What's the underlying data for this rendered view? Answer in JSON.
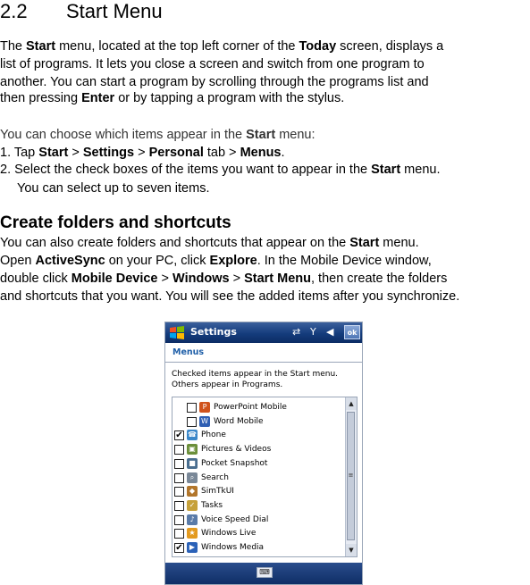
{
  "section": {
    "number": "2.2",
    "title": "Start Menu"
  },
  "intro": {
    "l1": [
      "The ",
      "Start",
      " menu, located at the top left corner of the ",
      "Today",
      " screen, displays a"
    ],
    "l2": "list of programs. It lets you close a screen and switch from one program to",
    "l3": "another. You can start a program by scrolling through the programs list and",
    "l4": [
      "then pressing ",
      "Enter",
      " or by tapping a program with the stylus."
    ]
  },
  "choose": {
    "l1": [
      "You can choose which items appear in the ",
      "Start",
      " menu:"
    ],
    "s1": [
      "1. Tap ",
      "Start",
      " > ",
      "Settings",
      " > ",
      "Personal",
      " tab > ",
      "Menus",
      "."
    ],
    "s2": [
      "2. Select the check boxes of the items you want to appear in the ",
      "Start",
      " menu."
    ],
    "s2b": "You can select up to seven items."
  },
  "folders": {
    "heading": "Create folders and shortcuts",
    "l1": [
      "You can also create folders and shortcuts that appear on the ",
      "Start",
      " menu."
    ],
    "l2": [
      "Open ",
      "ActiveSync",
      " on your PC, click ",
      "Explore",
      ". In the Mobile Device window,"
    ],
    "l3": [
      "double click ",
      "Mobile Device",
      " > ",
      "Windows",
      " > ",
      "Start Menu",
      ", then create the folders"
    ],
    "l4": "and shortcuts that you want. You will see the added items after you synchronize."
  },
  "device": {
    "title": "Settings",
    "ok": "ok",
    "tab": "Menus",
    "note1": "Checked items appear in the Start menu.",
    "note2": "Others appear in Programs.",
    "items": [
      {
        "label": "PowerPoint Mobile",
        "checked": false,
        "indent": true,
        "color": "#d0531c",
        "glyph": "P"
      },
      {
        "label": "Word Mobile",
        "checked": false,
        "indent": true,
        "color": "#2f5fb3",
        "glyph": "W"
      },
      {
        "label": "Phone",
        "checked": true,
        "indent": false,
        "color": "#3a87c9",
        "glyph": "☎"
      },
      {
        "label": "Pictures & Videos",
        "checked": false,
        "indent": false,
        "color": "#6b8f3a",
        "glyph": "▣"
      },
      {
        "label": "Pocket Snapshot",
        "checked": false,
        "indent": false,
        "color": "#4a6e8f",
        "glyph": "■"
      },
      {
        "label": "Search",
        "checked": false,
        "indent": false,
        "color": "#7a8898",
        "glyph": "⌕"
      },
      {
        "label": "SimTkUI",
        "checked": false,
        "indent": false,
        "color": "#b2762b",
        "glyph": "◆"
      },
      {
        "label": "Tasks",
        "checked": false,
        "indent": false,
        "color": "#c6a13a",
        "glyph": "✓"
      },
      {
        "label": "Voice Speed Dial",
        "checked": false,
        "indent": false,
        "color": "#5a7ba8",
        "glyph": "♪"
      },
      {
        "label": "Windows Live",
        "checked": false,
        "indent": false,
        "color": "#e39a1f",
        "glyph": "★"
      },
      {
        "label": "Windows Media",
        "checked": true,
        "indent": false,
        "color": "#2b62b8",
        "glyph": "▶"
      }
    ]
  }
}
